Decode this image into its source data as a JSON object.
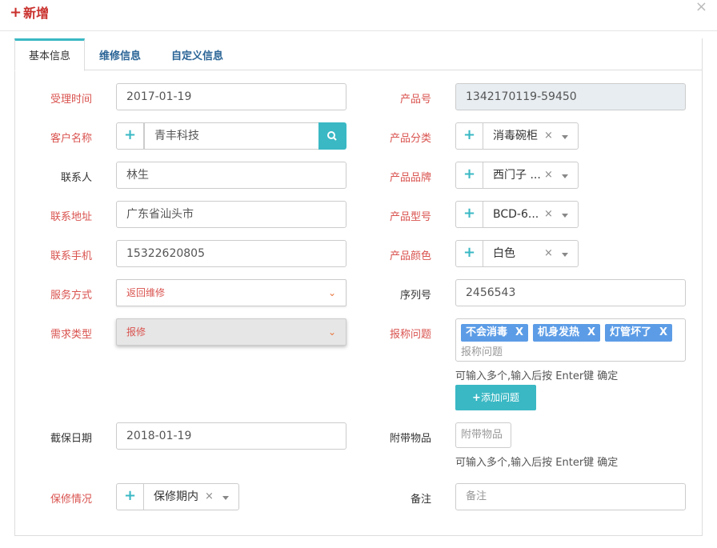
{
  "dialog": {
    "title": "新增",
    "close_glyph": "×"
  },
  "tabs": [
    "基本信息",
    "维修信息",
    "自定义信息"
  ],
  "left": {
    "accept_time": {
      "label": "受理时间",
      "value": "2017-01-19"
    },
    "customer": {
      "label": "客户名称",
      "value": "青丰科技"
    },
    "contact": {
      "label": "联系人",
      "value": "林生"
    },
    "address": {
      "label": "联系地址",
      "value": "广东省汕头市"
    },
    "phone": {
      "label": "联系手机",
      "value": "15322620805"
    },
    "service": {
      "label": "服务方式",
      "value": "返回维修"
    },
    "demand": {
      "label": "需求类型",
      "value": "报修"
    },
    "warranty_end": {
      "label": "截保日期",
      "value": "2018-01-19"
    },
    "warranty": {
      "label": "保修情况",
      "value": "保修期内"
    }
  },
  "right": {
    "product_no": {
      "label": "产品号",
      "value": "1342170119-59450"
    },
    "category": {
      "label": "产品分类",
      "value": "消毒碗柜"
    },
    "brand": {
      "label": "产品品牌",
      "value": "西门子 ..."
    },
    "model": {
      "label": "产品型号",
      "value": "BCD-6..."
    },
    "color": {
      "label": "产品颜色",
      "value": "白色"
    },
    "serial": {
      "label": "序列号",
      "value": "2456543"
    },
    "issues": {
      "label": "报称问题",
      "tags": [
        "不会消毒",
        "机身发热",
        "灯管坏了"
      ],
      "placeholder": "报称问题",
      "hint": "可输入多个,输入后按 Enter键 确定",
      "add_button": "添加问题"
    },
    "accessories": {
      "label": "附带物品",
      "placeholder": "附带物品",
      "hint": "可输入多个,输入后按 Enter键 确定"
    },
    "remark": {
      "label": "备注",
      "placeholder": "备注"
    }
  },
  "glyphs": {
    "plus": "+",
    "clear": "×",
    "tag_remove": "X",
    "chevron": "⌄"
  },
  "colors": {
    "accent": "#3ab8c4",
    "required": "#d9534f",
    "tag": "#5c9ce6",
    "link": "#2a6496"
  }
}
